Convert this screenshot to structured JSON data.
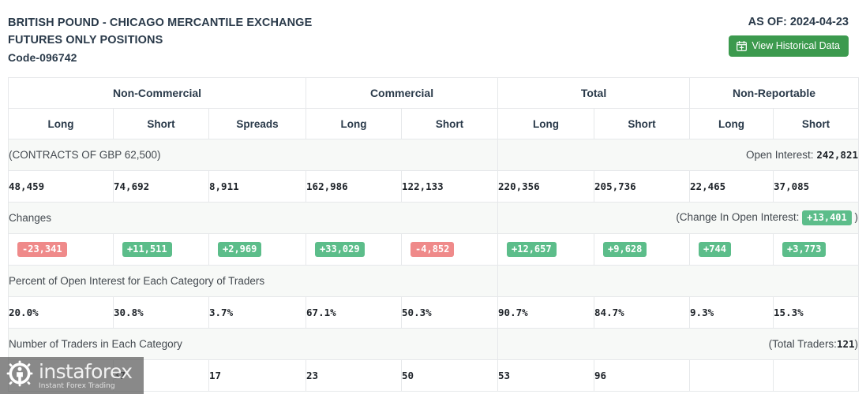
{
  "header": {
    "title_line1": "BRITISH POUND - CHICAGO MERCANTILE EXCHANGE",
    "title_line2": "FUTURES ONLY POSITIONS",
    "title_line3": "Code-096742",
    "as_of": "AS OF: 2024-04-23",
    "historical_button_label": "View Historical Data",
    "historical_button_icon": "calendar-plus-icon",
    "accent_green": "#3c9a4e"
  },
  "table": {
    "groups": [
      {
        "label": "Non-Commercial",
        "span": 3
      },
      {
        "label": "Commercial",
        "span": 2
      },
      {
        "label": "Total",
        "span": 2
      },
      {
        "label": "Non-Reportable",
        "span": 2
      }
    ],
    "columns": [
      "Long",
      "Short",
      "Spreads",
      "Long",
      "Short",
      "Long",
      "Short",
      "Long",
      "Short"
    ],
    "sections": [
      {
        "name": "contracts",
        "label": "(CONTRACTS OF GBP 62,500)",
        "summary_prefix": "Open Interest:",
        "summary_value": "242,821",
        "summary_suffix": "",
        "values": [
          "48,459",
          "74,692",
          "8,911",
          "162,986",
          "122,133",
          "220,356",
          "205,736",
          "22,465",
          "37,085"
        ],
        "style": "plain"
      },
      {
        "name": "changes",
        "label": "Changes",
        "summary_prefix": "(Change In Open Interest:",
        "summary_value": "+13,401",
        "summary_suffix": ")",
        "summary_value_style": "badge-pos",
        "values": [
          "-23,341",
          "+11,511",
          "+2,969",
          "+33,029",
          "-4,852",
          "+12,657",
          "+9,628",
          "+744",
          "+3,773"
        ],
        "value_styles": [
          "neg",
          "pos",
          "pos",
          "pos",
          "neg",
          "pos",
          "pos",
          "pos",
          "pos"
        ],
        "style": "badge"
      },
      {
        "name": "percent-open-interest",
        "label": "Percent of Open Interest for Each Category of Traders",
        "summary_prefix": "",
        "summary_value": "",
        "summary_suffix": "",
        "values": [
          "20.0%",
          "30.8%",
          "3.7%",
          "67.1%",
          "50.3%",
          "90.7%",
          "84.7%",
          "9.3%",
          "15.3%"
        ],
        "style": "plain"
      },
      {
        "name": "number-of-traders",
        "label": "Number of Traders in Each Category",
        "summary_prefix": "(Total Traders:",
        "summary_value": "121",
        "summary_suffix": ")",
        "values": [
          "",
          "37",
          "17",
          "23",
          "50",
          "53",
          "96",
          "",
          ""
        ],
        "style": "plain"
      }
    ],
    "badge_colors": {
      "positive": "#5cbd8a",
      "negative": "#ef8a8a"
    }
  },
  "watermark": {
    "name": "instaforex",
    "tagline": "Instant Forex Trading"
  }
}
